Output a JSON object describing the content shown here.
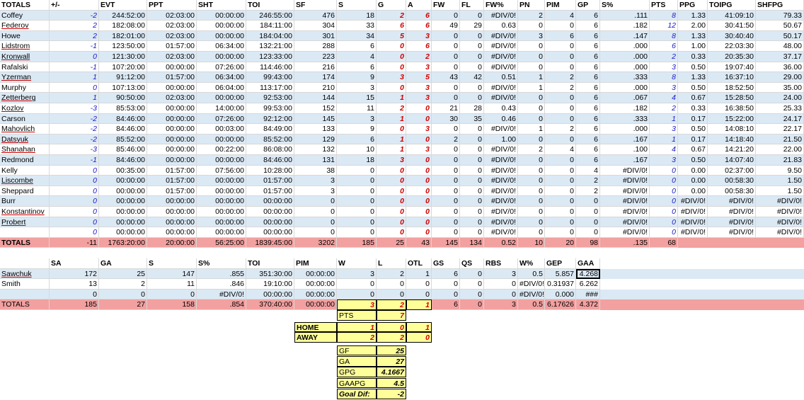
{
  "skater_headers": [
    "TOTALS",
    "+/-",
    "EVT",
    "PPT",
    "SHT",
    "TOI",
    "SF",
    "S",
    "G",
    "A",
    "FW",
    "FL",
    "FW%",
    "PN",
    "PIM",
    "GP",
    "S%",
    "PTS",
    "PPG",
    "TOIPG",
    "SHFPG"
  ],
  "skaters": [
    {
      "name": "Coffey",
      "pm": "-2",
      "evt": "244:52:00",
      "ppt": "02:03:00",
      "sht": "00:00:00",
      "toi": "246:55:00",
      "sf": "476",
      "s": "18",
      "g": "2",
      "a": "6",
      "fw": "0",
      "fl": "0",
      "fwp": "#DIV/0!",
      "pn": "2",
      "pim": "4",
      "gp": "6",
      "sp": ".111",
      "pts": "8",
      "ppg": "1.33",
      "toipg": "41:09:10",
      "shfpg": "79.33",
      "ul": false
    },
    {
      "name": "Federov",
      "pm": "2",
      "evt": "182:08:00",
      "ppt": "02:03:00",
      "sht": "00:00:00",
      "toi": "184:11:00",
      "sf": "304",
      "s": "33",
      "g": "6",
      "a": "6",
      "fw": "49",
      "fl": "29",
      "fwp": "0.63",
      "pn": "0",
      "pim": "0",
      "gp": "6",
      "sp": ".182",
      "pts": "12",
      "ppg": "2.00",
      "toipg": "30:41:50",
      "shfpg": "50.67",
      "ul": true
    },
    {
      "name": "Howe",
      "pm": "2",
      "evt": "182:01:00",
      "ppt": "02:03:00",
      "sht": "00:00:00",
      "toi": "184:04:00",
      "sf": "301",
      "s": "34",
      "g": "5",
      "a": "3",
      "fw": "0",
      "fl": "0",
      "fwp": "#DIV/0!",
      "pn": "3",
      "pim": "6",
      "gp": "6",
      "sp": ".147",
      "pts": "8",
      "ppg": "1.33",
      "toipg": "30:40:40",
      "shfpg": "50.17",
      "ul": false
    },
    {
      "name": "Lidstrom",
      "pm": "-1",
      "evt": "123:50:00",
      "ppt": "01:57:00",
      "sht": "06:34:00",
      "toi": "132:21:00",
      "sf": "288",
      "s": "6",
      "g": "0",
      "a": "6",
      "fw": "0",
      "fl": "0",
      "fwp": "#DIV/0!",
      "pn": "0",
      "pim": "0",
      "gp": "6",
      "sp": ".000",
      "pts": "6",
      "ppg": "1.00",
      "toipg": "22:03:30",
      "shfpg": "48.00",
      "ul": true
    },
    {
      "name": "Kronwall",
      "pm": "0",
      "evt": "121:30:00",
      "ppt": "02:03:00",
      "sht": "00:00:00",
      "toi": "123:33:00",
      "sf": "223",
      "s": "4",
      "g": "0",
      "a": "2",
      "fw": "0",
      "fl": "0",
      "fwp": "#DIV/0!",
      "pn": "0",
      "pim": "0",
      "gp": "6",
      "sp": ".000",
      "pts": "2",
      "ppg": "0.33",
      "toipg": "20:35:30",
      "shfpg": "37.17",
      "ul": true
    },
    {
      "name": "Rafalski",
      "pm": "-1",
      "evt": "107:20:00",
      "ppt": "00:00:00",
      "sht": "07:26:00",
      "toi": "114:46:00",
      "sf": "216",
      "s": "6",
      "g": "0",
      "a": "3",
      "fw": "0",
      "fl": "0",
      "fwp": "#DIV/0!",
      "pn": "0",
      "pim": "0",
      "gp": "6",
      "sp": ".000",
      "pts": "3",
      "ppg": "0.50",
      "toipg": "19:07:40",
      "shfpg": "36.00",
      "ul": false
    },
    {
      "name": "Yzerman",
      "pm": "1",
      "evt": "91:12:00",
      "ppt": "01:57:00",
      "sht": "06:34:00",
      "toi": "99:43:00",
      "sf": "174",
      "s": "9",
      "g": "3",
      "a": "5",
      "fw": "43",
      "fl": "42",
      "fwp": "0.51",
      "pn": "1",
      "pim": "2",
      "gp": "6",
      "sp": ".333",
      "pts": "8",
      "ppg": "1.33",
      "toipg": "16:37:10",
      "shfpg": "29.00",
      "ul": true
    },
    {
      "name": "Murphy",
      "pm": "0",
      "evt": "107:13:00",
      "ppt": "00:00:00",
      "sht": "06:04:00",
      "toi": "113:17:00",
      "sf": "210",
      "s": "3",
      "g": "0",
      "a": "3",
      "fw": "0",
      "fl": "0",
      "fwp": "#DIV/0!",
      "pn": "1",
      "pim": "2",
      "gp": "6",
      "sp": ".000",
      "pts": "3",
      "ppg": "0.50",
      "toipg": "18:52:50",
      "shfpg": "35.00",
      "ul": false
    },
    {
      "name": "Zetterberg",
      "pm": "1",
      "evt": "90:50:00",
      "ppt": "02:03:00",
      "sht": "00:00:00",
      "toi": "92:53:00",
      "sf": "144",
      "s": "15",
      "g": "1",
      "a": "3",
      "fw": "0",
      "fl": "0",
      "fwp": "#DIV/0!",
      "pn": "0",
      "pim": "0",
      "gp": "6",
      "sp": ".067",
      "pts": "4",
      "ppg": "0.67",
      "toipg": "15:28:50",
      "shfpg": "24.00",
      "ul": true
    },
    {
      "name": "Kozlov",
      "pm": "-3",
      "evt": "85:53:00",
      "ppt": "00:00:00",
      "sht": "14:00:00",
      "toi": "99:53:00",
      "sf": "152",
      "s": "11",
      "g": "2",
      "a": "0",
      "fw": "21",
      "fl": "28",
      "fwp": "0.43",
      "pn": "0",
      "pim": "0",
      "gp": "6",
      "sp": ".182",
      "pts": "2",
      "ppg": "0.33",
      "toipg": "16:38:50",
      "shfpg": "25.33",
      "ul": true
    },
    {
      "name": "Carson",
      "pm": "-2",
      "evt": "84:46:00",
      "ppt": "00:00:00",
      "sht": "07:26:00",
      "toi": "92:12:00",
      "sf": "145",
      "s": "3",
      "g": "1",
      "a": "0",
      "fw": "30",
      "fl": "35",
      "fwp": "0.46",
      "pn": "0",
      "pim": "0",
      "gp": "6",
      "sp": ".333",
      "pts": "1",
      "ppg": "0.17",
      "toipg": "15:22:00",
      "shfpg": "24.17",
      "ul": false
    },
    {
      "name": "Mahovlich",
      "pm": "-2",
      "evt": "84:46:00",
      "ppt": "00:00:00",
      "sht": "00:03:00",
      "toi": "84:49:00",
      "sf": "133",
      "s": "9",
      "g": "0",
      "a": "3",
      "fw": "0",
      "fl": "0",
      "fwp": "#DIV/0!",
      "pn": "1",
      "pim": "2",
      "gp": "6",
      "sp": ".000",
      "pts": "3",
      "ppg": "0.50",
      "toipg": "14:08:10",
      "shfpg": "22.17",
      "ul": true
    },
    {
      "name": "Datsyuk",
      "pm": "-2",
      "evt": "85:52:00",
      "ppt": "00:00:00",
      "sht": "00:00:00",
      "toi": "85:52:00",
      "sf": "129",
      "s": "6",
      "g": "1",
      "a": "0",
      "fw": "2",
      "fl": "0",
      "fwp": "1.00",
      "pn": "0",
      "pim": "0",
      "gp": "6",
      "sp": ".167",
      "pts": "1",
      "ppg": "0.17",
      "toipg": "14:18:40",
      "shfpg": "21.50",
      "ul": true
    },
    {
      "name": "Shanahan",
      "pm": "-3",
      "evt": "85:46:00",
      "ppt": "00:00:00",
      "sht": "00:22:00",
      "toi": "86:08:00",
      "sf": "132",
      "s": "10",
      "g": "1",
      "a": "3",
      "fw": "0",
      "fl": "0",
      "fwp": "#DIV/0!",
      "pn": "2",
      "pim": "4",
      "gp": "6",
      "sp": ".100",
      "pts": "4",
      "ppg": "0.67",
      "toipg": "14:21:20",
      "shfpg": "22.00",
      "ul": true
    },
    {
      "name": "Redmond",
      "pm": "-1",
      "evt": "84:46:00",
      "ppt": "00:00:00",
      "sht": "00:00:00",
      "toi": "84:46:00",
      "sf": "131",
      "s": "18",
      "g": "3",
      "a": "0",
      "fw": "0",
      "fl": "0",
      "fwp": "#DIV/0!",
      "pn": "0",
      "pim": "0",
      "gp": "6",
      "sp": ".167",
      "pts": "3",
      "ppg": "0.50",
      "toipg": "14:07:40",
      "shfpg": "21.83",
      "ul": false
    },
    {
      "name": "Kelly",
      "pm": "0",
      "evt": "00:35:00",
      "ppt": "01:57:00",
      "sht": "07:56:00",
      "toi": "10:28:00",
      "sf": "38",
      "s": "0",
      "g": "0",
      "a": "0",
      "fw": "0",
      "fl": "0",
      "fwp": "#DIV/0!",
      "pn": "0",
      "pim": "0",
      "gp": "4",
      "sp": "#DIV/0!",
      "pts": "0",
      "ppg": "0.00",
      "toipg": "02:37:00",
      "shfpg": "9.50",
      "ul": false
    },
    {
      "name": "Liscombe",
      "pm": "0",
      "evt": "00:00:00",
      "ppt": "01:57:00",
      "sht": "00:00:00",
      "toi": "01:57:00",
      "sf": "3",
      "s": "0",
      "g": "0",
      "a": "0",
      "fw": "0",
      "fl": "0",
      "fwp": "#DIV/0!",
      "pn": "0",
      "pim": "0",
      "gp": "2",
      "sp": "#DIV/0!",
      "pts": "0",
      "ppg": "0.00",
      "toipg": "00:58:30",
      "shfpg": "1.50",
      "ul": true
    },
    {
      "name": "Sheppard",
      "pm": "0",
      "evt": "00:00:00",
      "ppt": "01:57:00",
      "sht": "00:00:00",
      "toi": "01:57:00",
      "sf": "3",
      "s": "0",
      "g": "0",
      "a": "0",
      "fw": "0",
      "fl": "0",
      "fwp": "#DIV/0!",
      "pn": "0",
      "pim": "0",
      "gp": "2",
      "sp": "#DIV/0!",
      "pts": "0",
      "ppg": "0.00",
      "toipg": "00:58:30",
      "shfpg": "1.50",
      "ul": false
    },
    {
      "name": "Burr",
      "pm": "0",
      "evt": "00:00:00",
      "ppt": "00:00:00",
      "sht": "00:00:00",
      "toi": "00:00:00",
      "sf": "0",
      "s": "0",
      "g": "0",
      "a": "0",
      "fw": "0",
      "fl": "0",
      "fwp": "#DIV/0!",
      "pn": "0",
      "pim": "0",
      "gp": "0",
      "sp": "#DIV/0!",
      "pts": "0",
      "ppg": "#DIV/0!",
      "toipg": "#DIV/0!",
      "shfpg": "#DIV/0!",
      "ul": false
    },
    {
      "name": "Konstantinov",
      "pm": "0",
      "evt": "00:00:00",
      "ppt": "00:00:00",
      "sht": "00:00:00",
      "toi": "00:00:00",
      "sf": "0",
      "s": "0",
      "g": "0",
      "a": "0",
      "fw": "0",
      "fl": "0",
      "fwp": "#DIV/0!",
      "pn": "0",
      "pim": "0",
      "gp": "0",
      "sp": "#DIV/0!",
      "pts": "0",
      "ppg": "#DIV/0!",
      "toipg": "#DIV/0!",
      "shfpg": "#DIV/0!",
      "ul": true
    },
    {
      "name": "Probert",
      "pm": "0",
      "evt": "00:00:00",
      "ppt": "00:00:00",
      "sht": "00:00:00",
      "toi": "00:00:00",
      "sf": "0",
      "s": "0",
      "g": "0",
      "a": "0",
      "fw": "0",
      "fl": "0",
      "fwp": "#DIV/0!",
      "pn": "0",
      "pim": "0",
      "gp": "0",
      "sp": "#DIV/0!",
      "pts": "0",
      "ppg": "#DIV/0!",
      "toipg": "#DIV/0!",
      "shfpg": "#DIV/0!",
      "ul": true
    },
    {
      "name": "",
      "pm": "0",
      "evt": "00:00:00",
      "ppt": "00:00:00",
      "sht": "00:00:00",
      "toi": "00:00:00",
      "sf": "0",
      "s": "0",
      "g": "0",
      "a": "0",
      "fw": "0",
      "fl": "0",
      "fwp": "#DIV/0!",
      "pn": "0",
      "pim": "0",
      "gp": "0",
      "sp": "#DIV/0!",
      "pts": "0",
      "ppg": "#DIV/0!",
      "toipg": "#DIV/0!",
      "shfpg": "#DIV/0!",
      "ul": false
    }
  ],
  "skater_totals": {
    "name": "TOTALS",
    "pm": "-11",
    "evt": "1763:20:00",
    "ppt": "20:00:00",
    "sht": "56:25:00",
    "toi": "1839:45:00",
    "sf": "3202",
    "s": "185",
    "g": "25",
    "a": "43",
    "fw": "145",
    "fl": "134",
    "fwp": "0.52",
    "pn": "10",
    "pim": "20",
    "gp": "98",
    "sp": ".135",
    "pts": "68"
  },
  "goalie_headers": [
    "",
    "SA",
    "GA",
    "S",
    "S%",
    "TOI",
    "PIM",
    "W",
    "L",
    "OTL",
    "GS",
    "QS",
    "RBS",
    "W%",
    "GEP",
    "GAA"
  ],
  "goalies": [
    {
      "name": "Sawchuk",
      "sa": "172",
      "ga": "25",
      "s": "147",
      "sp": ".855",
      "toi": "351:30:00",
      "pim": "00:00:00",
      "w": "3",
      "l": "2",
      "otl": "1",
      "gs": "6",
      "qs": "0",
      "rbs": "3",
      "wp": "0.5",
      "gep": "5.857",
      "gaa": "4.268",
      "ul": true
    },
    {
      "name": "Smith",
      "sa": "13",
      "ga": "2",
      "s": "11",
      "sp": ".846",
      "toi": "19:10:00",
      "pim": "00:00:00",
      "w": "0",
      "l": "0",
      "otl": "0",
      "gs": "0",
      "qs": "0",
      "rbs": "0",
      "wp": "#DIV/0!",
      "gep": "0.31937",
      "gaa": "6.262",
      "ul": false
    },
    {
      "name": "",
      "sa": "0",
      "ga": "0",
      "s": "0",
      "sp": "#DIV/0!",
      "toi": "00:00:00",
      "pim": "00:00:00",
      "w": "0",
      "l": "0",
      "otl": "0",
      "gs": "0",
      "qs": "0",
      "rbs": "0",
      "wp": "#DIV/0!",
      "gep": "0.000",
      "gaa": "###",
      "ul": false
    }
  ],
  "goalie_totals": {
    "name": "TOTALS",
    "sa": "185",
    "ga": "27",
    "s": "158",
    "sp": ".854",
    "toi": "370:40:00",
    "pim": "00:00:00",
    "w": "3",
    "l": "2",
    "otl": "1",
    "gs": "6",
    "qs": "0",
    "rbs": "3",
    "wp": "0.5",
    "gep": "6.17626",
    "gaa": "4.372"
  },
  "summary": {
    "pts_label": "PTS",
    "pts": "7",
    "home_label": "HOME",
    "home_w": "1",
    "home_l": "0",
    "home_otl": "1",
    "away_label": "AWAY",
    "away_w": "2",
    "away_l": "2",
    "away_otl": "0",
    "gf_label": "GF",
    "gf": "25",
    "ga_label": "GA",
    "ga": "27",
    "gpg_label": "GPG",
    "gpg": "4.1667",
    "gaapg_label": "GAAPG",
    "gaapg": "4.5",
    "goaldif_label": "Goal Dif:",
    "goaldif": "-2"
  }
}
